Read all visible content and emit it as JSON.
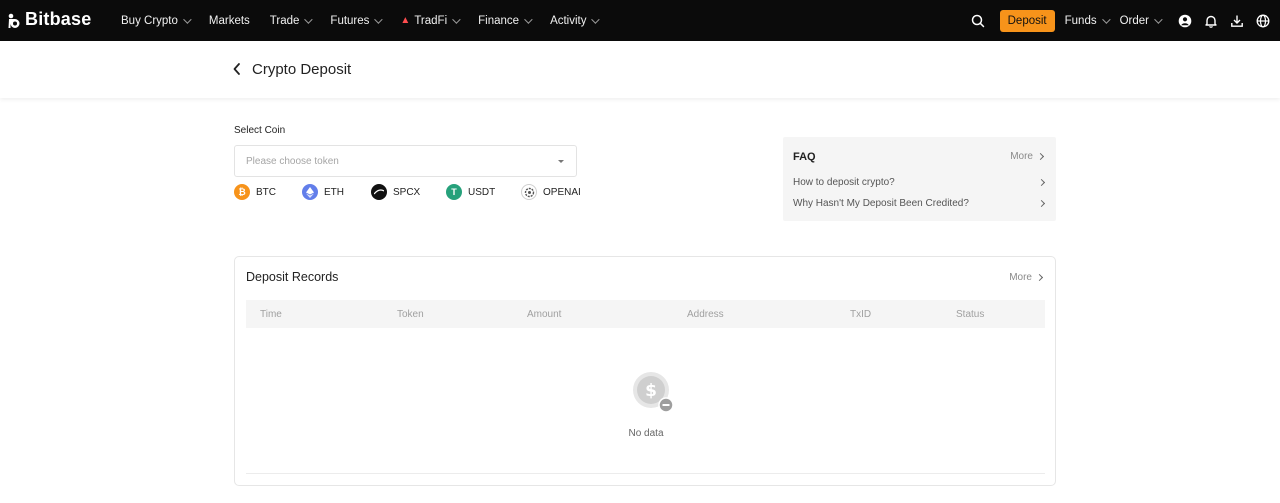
{
  "brand": {
    "name": "Bitbase"
  },
  "nav": {
    "items": [
      {
        "label": "Buy Crypto",
        "has_caret": true
      },
      {
        "label": "Markets",
        "has_caret": false
      },
      {
        "label": "Trade",
        "has_caret": true
      },
      {
        "label": "Futures",
        "has_caret": true
      },
      {
        "label": "TradFi",
        "has_caret": true,
        "icon": "flame-icon"
      },
      {
        "label": "Finance",
        "has_caret": true
      },
      {
        "label": "Activity",
        "has_caret": true
      }
    ],
    "deposit_label": "Deposit",
    "funds_label": "Funds",
    "order_label": "Order",
    "accent": "#f7931a"
  },
  "page": {
    "title": "Crypto Deposit"
  },
  "select_coin": {
    "label": "Select Coin",
    "placeholder": "Please choose token",
    "quick_coins": [
      {
        "symbol": "BTC",
        "color": "#f7931a",
        "icon": "bitcoin-icon"
      },
      {
        "symbol": "ETH",
        "color": "#627eea",
        "icon": "ethereum-icon"
      },
      {
        "symbol": "SPCX",
        "color": "#111111",
        "icon": "spcx-icon"
      },
      {
        "symbol": "USDT",
        "color": "#26a17b",
        "icon": "tether-icon"
      },
      {
        "symbol": "OPENAI",
        "color": "#555555",
        "icon": "openai-icon"
      }
    ]
  },
  "faq": {
    "title": "FAQ",
    "more_label": "More",
    "items": [
      "How to deposit crypto?",
      "Why Hasn't My Deposit Been Credited?"
    ]
  },
  "records": {
    "title": "Deposit Records",
    "more_label": "More",
    "columns": [
      "Time",
      "Token",
      "Amount",
      "Address",
      "TxID",
      "Status"
    ],
    "empty_text": "No data"
  }
}
